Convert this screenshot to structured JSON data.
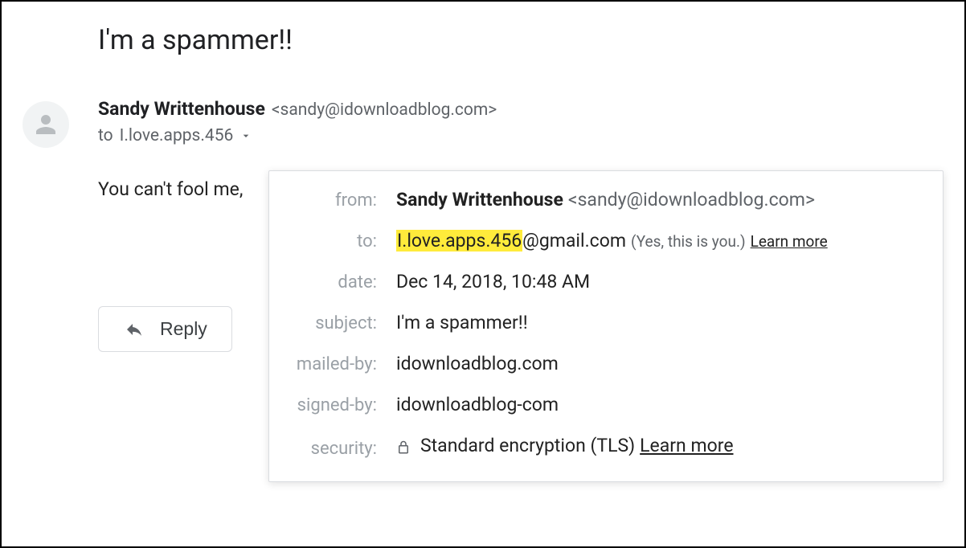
{
  "subject": "I'm a spammer!!",
  "sender": {
    "name": "Sandy Writtenhouse",
    "email": "<sandy@idownloadblog.com>"
  },
  "toLine": {
    "prefix": "to",
    "recipient": "I.love.apps.456"
  },
  "body": "You can't fool me,",
  "replyButton": "Reply",
  "details": {
    "labels": {
      "from": "from:",
      "to": "to:",
      "date": "date:",
      "subject": "subject:",
      "mailedBy": "mailed-by:",
      "signedBy": "signed-by:",
      "security": "security:"
    },
    "from": {
      "name": "Sandy Writtenhouse",
      "email": "<sandy@idownloadblog.com>"
    },
    "to": {
      "highlighted": "I.love.apps.456",
      "rest": "@gmail.com",
      "note": "(Yes, this is you.)",
      "learnMore": "Learn more"
    },
    "date": "Dec 14, 2018, 10:48 AM",
    "subject": "I'm a spammer!!",
    "mailedBy": "idownloadblog.com",
    "signedBy": "idownloadblog-com",
    "security": {
      "text": "Standard encryption (TLS)",
      "learnMore": "Learn more"
    }
  }
}
